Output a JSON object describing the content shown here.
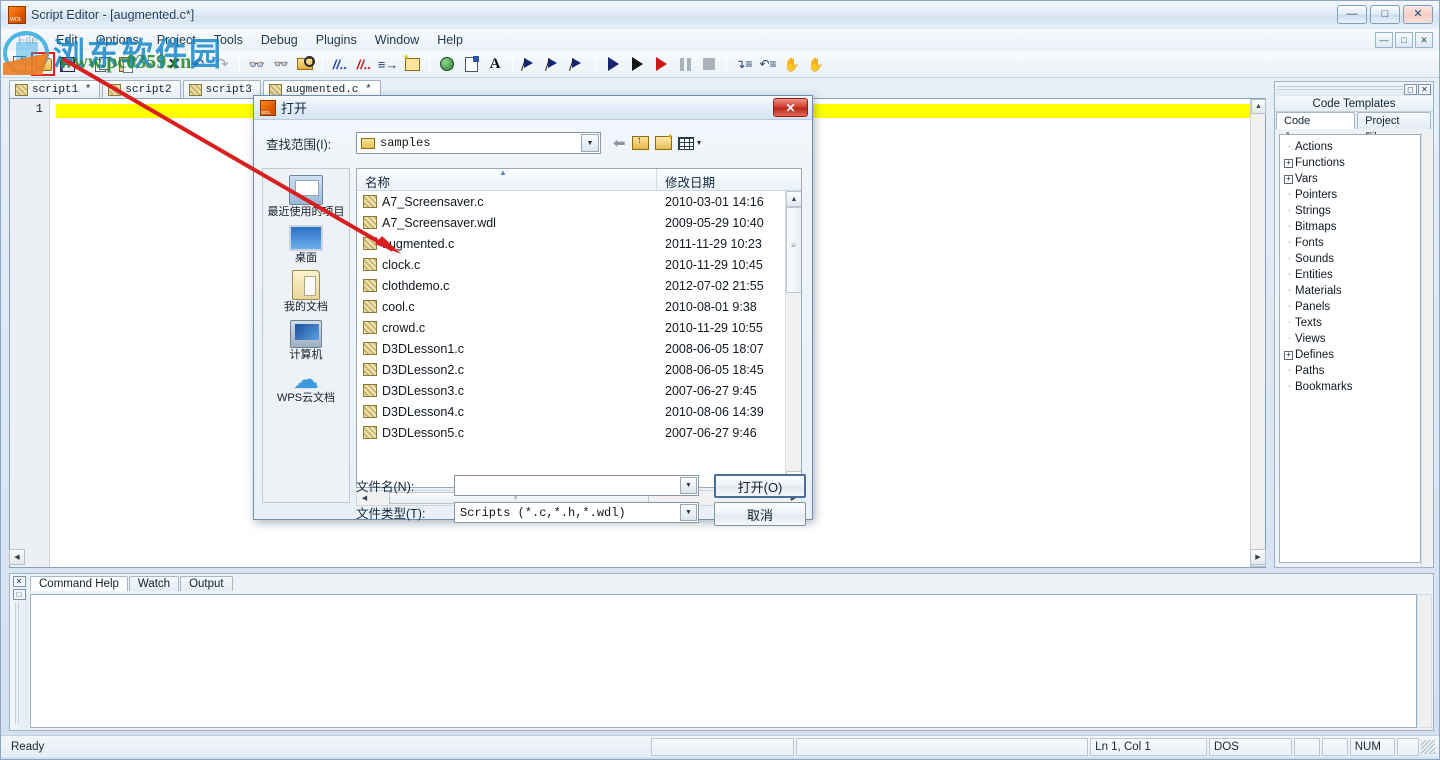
{
  "window": {
    "title": "Script Editor - [augmented.c*]",
    "controls": {
      "minimize": "—",
      "maximize": "□",
      "close": "✕"
    }
  },
  "menubar": {
    "items": [
      "File",
      "Edit",
      "Options",
      "Project",
      "Tools",
      "Debug",
      "Plugins",
      "Window",
      "Help"
    ],
    "mdi_buttons": [
      "—",
      "□",
      "✕"
    ]
  },
  "toolbar": {
    "icons": [
      "new-file-icon",
      "open-file-icon",
      "save-file-icon",
      "copy-icon",
      "paste-icon",
      "cut-icon",
      "delete-icon",
      "undo-icon",
      "redo-icon",
      "find-icon",
      "find-next-icon",
      "find-in-files-icon",
      "comment-icon",
      "uncomment-icon",
      "indent-icon",
      "new-template-icon",
      "web-icon",
      "properties-icon",
      "font-icon",
      "bookmark-toggle-icon",
      "bookmark-next-icon",
      "bookmark-prev-icon",
      "run-icon",
      "run-debug-icon",
      "run-stop-icon",
      "pause-icon",
      "stop-icon",
      "step-into-icon",
      "step-over-icon",
      "hand-icon",
      "hand-disabled-icon"
    ],
    "highlighted": "open-file-icon"
  },
  "doc_tabs": [
    {
      "label": "script1 *",
      "active": false
    },
    {
      "label": "script2",
      "active": false
    },
    {
      "label": "script3",
      "active": false
    },
    {
      "label": "augmented.c *",
      "active": true
    }
  ],
  "editor": {
    "line_numbers": [
      "1"
    ],
    "highlight_color": "#ffff00"
  },
  "right_dock": {
    "title": "Code Templates",
    "tabs": [
      {
        "label": "Code Jumper",
        "active": true
      },
      {
        "label": "Project Files",
        "active": false
      }
    ],
    "tree": [
      {
        "label": "Actions",
        "expandable": false
      },
      {
        "label": "Functions",
        "expandable": true
      },
      {
        "label": "Vars",
        "expandable": true
      },
      {
        "label": "Pointers",
        "expandable": false
      },
      {
        "label": "Strings",
        "expandable": false
      },
      {
        "label": "Bitmaps",
        "expandable": false
      },
      {
        "label": "Fonts",
        "expandable": false
      },
      {
        "label": "Sounds",
        "expandable": false
      },
      {
        "label": "Entities",
        "expandable": false
      },
      {
        "label": "Materials",
        "expandable": false
      },
      {
        "label": "Panels",
        "expandable": false
      },
      {
        "label": "Texts",
        "expandable": false
      },
      {
        "label": "Views",
        "expandable": false
      },
      {
        "label": "Defines",
        "expandable": true
      },
      {
        "label": "Paths",
        "expandable": false
      },
      {
        "label": "Bookmarks",
        "expandable": false
      }
    ],
    "expand_glyph": "+"
  },
  "bottom_dock": {
    "tabs": [
      {
        "label": "Command Help",
        "active": true
      },
      {
        "label": "Watch",
        "active": false
      },
      {
        "label": "Output",
        "active": false
      }
    ],
    "buttons": [
      "✕",
      "□"
    ]
  },
  "statusbar": {
    "ready": "Ready",
    "position": "Ln 1, Col 1",
    "line_ending": "DOS",
    "num_lock": "NUM"
  },
  "dialog": {
    "title": "打开",
    "close_label": "✕",
    "lookin_label": "查找范围(I):",
    "lookin_value": "samples",
    "nav": {
      "back": "back-icon",
      "up": "up-one-level-icon",
      "new_folder": "new-folder-icon",
      "views": "views-icon"
    },
    "places": [
      {
        "label": "最近使用的项目",
        "icon": "recent-items-icon"
      },
      {
        "label": "桌面",
        "icon": "desktop-icon"
      },
      {
        "label": "我的文档",
        "icon": "my-documents-icon"
      },
      {
        "label": "计算机",
        "icon": "computer-icon"
      },
      {
        "label": "WPS云文档",
        "icon": "wps-cloud-icon"
      }
    ],
    "columns": [
      "名称",
      "修改日期"
    ],
    "files": [
      {
        "name": "A7_Screensaver.c",
        "date": "2010-03-01 14:16"
      },
      {
        "name": "A7_Screensaver.wdl",
        "date": "2009-05-29 10:40"
      },
      {
        "name": "augmented.c",
        "date": "2011-11-29 10:23"
      },
      {
        "name": "clock.c",
        "date": "2010-11-29 10:45"
      },
      {
        "name": "clothdemo.c",
        "date": "2012-07-02 21:55"
      },
      {
        "name": "cool.c",
        "date": "2010-08-01 9:38"
      },
      {
        "name": "crowd.c",
        "date": "2010-11-29 10:55"
      },
      {
        "name": "D3DLesson1.c",
        "date": "2008-06-05 18:07"
      },
      {
        "name": "D3DLesson2.c",
        "date": "2008-06-05 18:45"
      },
      {
        "name": "D3DLesson3.c",
        "date": "2007-06-27 9:45"
      },
      {
        "name": "D3DLesson4.c",
        "date": "2010-08-06 14:39"
      },
      {
        "name": "D3DLesson5.c",
        "date": "2007-06-27 9:46"
      }
    ],
    "filename_label": "文件名(N):",
    "filename_value": "",
    "filetype_label": "文件类型(T):",
    "filetype_value": "Scripts (*.c,*.h,*.wdl)",
    "open_button": "打开(O)",
    "cancel_button": "取消"
  },
  "watermark": {
    "site_name": "浏东软件园",
    "url": "www.pc0359.cn"
  }
}
